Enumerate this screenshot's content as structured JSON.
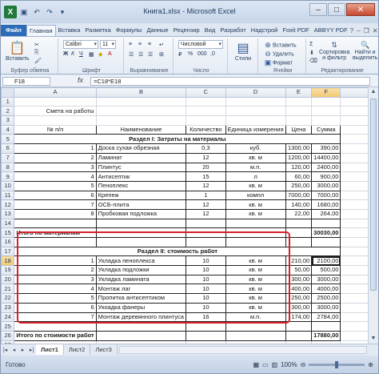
{
  "window": {
    "title": "Книга1.xlsx - Microsoft Excel"
  },
  "tabs": [
    "Файл",
    "Главная",
    "Вставка",
    "Разметка",
    "Формулы",
    "Данные",
    "Рецензир",
    "Вид",
    "Разработ",
    "Надстрой",
    "Foxit PDF",
    "ABBYY PDF"
  ],
  "ribbon": {
    "paste": "Вставить",
    "font_name": "Calibri",
    "font_size": "11",
    "number_format": "Числовой",
    "styles": "Стили",
    "insert": "Вставить",
    "delete": "Удалить",
    "format": "Формат",
    "sort": "Сортировка\nи фильтр",
    "find": "Найти и\nвыделить",
    "groups": [
      "Буфер обмена",
      "Шрифт",
      "Выравнивание",
      "Число",
      "Ячейки",
      "Редактирование"
    ]
  },
  "formula_bar": {
    "name_box": "F18",
    "fx": "fx",
    "formula": "=C18*E18"
  },
  "columns": [
    "A",
    "B",
    "C",
    "D",
    "E",
    "F"
  ],
  "rows": [
    {
      "n": "1",
      "cells": [
        "",
        "",
        "",
        "",
        "",
        ""
      ]
    },
    {
      "n": "2",
      "cells": [
        "Смета на работы",
        "",
        "",
        "",
        "",
        ""
      ]
    },
    {
      "n": "3",
      "cells": [
        "",
        "",
        "",
        "",
        "",
        ""
      ]
    },
    {
      "n": "4",
      "cells": [
        "№ п/п",
        "Наименование",
        "Количество",
        "Единица измерения",
        "Цена",
        "Сумма"
      ]
    },
    {
      "n": "5",
      "cells": [
        "Раздел I: Затраты на материалы"
      ]
    },
    {
      "n": "6",
      "cells": [
        "1",
        "Доска сухая обрезная",
        "0,3",
        "куб.",
        "1300,00",
        "390,00"
      ]
    },
    {
      "n": "7",
      "cells": [
        "2",
        "Ламинат",
        "12",
        "кв. м",
        "1200,00",
        "14400,00"
      ]
    },
    {
      "n": "8",
      "cells": [
        "3",
        "Плинтус",
        "20",
        "м.п.",
        "120,00",
        "2400,00"
      ]
    },
    {
      "n": "9",
      "cells": [
        "4",
        "Антисептик",
        "15",
        "л",
        "60,00",
        "900,00"
      ]
    },
    {
      "n": "10",
      "cells": [
        "5",
        "Пеноплекс",
        "12",
        "кв. м",
        "250,00",
        "3000,00"
      ]
    },
    {
      "n": "11",
      "cells": [
        "6",
        "Крепеж",
        "1",
        "компл",
        "7000,00",
        "7000,00"
      ]
    },
    {
      "n": "12",
      "cells": [
        "7",
        "ОСБ-плита",
        "12",
        "кв. м",
        "140,00",
        "1680,00"
      ]
    },
    {
      "n": "13",
      "cells": [
        "8",
        "Пробковая подложка",
        "12",
        "кв. м",
        "22,00",
        "264,00"
      ]
    },
    {
      "n": "14",
      "cells": [
        "",
        "",
        "",
        "",
        "",
        ""
      ]
    },
    {
      "n": "15",
      "cells": [
        "Итого по материалам",
        "",
        "",
        "",
        "",
        "30030,00"
      ]
    },
    {
      "n": "16",
      "cells": [
        "",
        "",
        "",
        "",
        "",
        ""
      ]
    },
    {
      "n": "17",
      "cells": [
        "Раздел II: стоимость работ"
      ]
    },
    {
      "n": "18",
      "cells": [
        "1",
        "Укладка пеноплекса",
        "10",
        "кв. м",
        "210,00",
        "2100,00"
      ]
    },
    {
      "n": "19",
      "cells": [
        "2",
        "Укладка подложки",
        "10",
        "кв. м",
        "50,00",
        "500,00"
      ]
    },
    {
      "n": "20",
      "cells": [
        "3",
        "Укладка  ламината",
        "10",
        "кв. м",
        "300,00",
        "3000,00"
      ]
    },
    {
      "n": "21",
      "cells": [
        "4",
        "Монтаж лаг",
        "10",
        "кв. м",
        "400,00",
        "4000,00"
      ]
    },
    {
      "n": "22",
      "cells": [
        "5",
        "Пропитка антисептиком",
        "10",
        "кв. м",
        "250,00",
        "2500,00"
      ]
    },
    {
      "n": "23",
      "cells": [
        "6",
        "Укоадка фанеры",
        "10",
        "кв. м",
        "300,00",
        "3000,00"
      ]
    },
    {
      "n": "24",
      "cells": [
        "7",
        "Монтаж деревянного плинтуса",
        "16",
        "м.п.",
        "174,00",
        "2784,00"
      ]
    },
    {
      "n": "25",
      "cells": [
        "",
        "",
        "",
        "",
        "",
        ""
      ]
    },
    {
      "n": "26",
      "cells": [
        "Итого по стоимости работ",
        "",
        "",
        "",
        "",
        "17880,00"
      ]
    },
    {
      "n": "27",
      "cells": [
        "",
        "",
        "",
        "",
        "",
        ""
      ]
    }
  ],
  "sheets": [
    "Лист1",
    "Лист2",
    "Лист3"
  ],
  "status": {
    "ready": "Готово",
    "zoom": "100%"
  },
  "colors": {
    "file_tab": "#2b6bb8",
    "highlight": "#d6212b",
    "excel_green": "#1f7a3a"
  }
}
